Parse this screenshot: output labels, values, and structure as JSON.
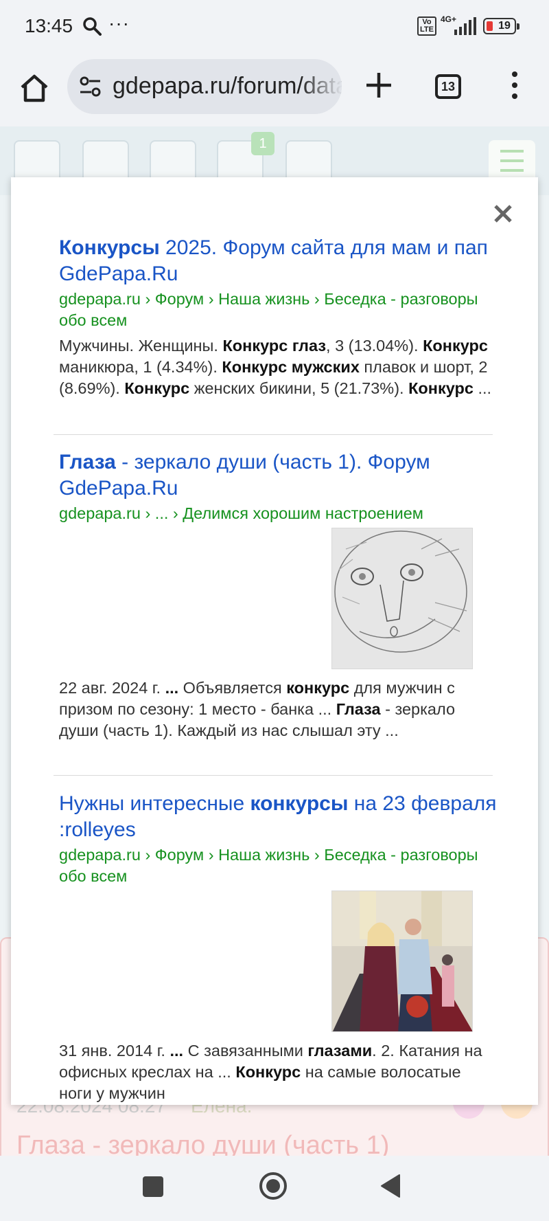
{
  "status_bar": {
    "time": "13:45",
    "overflow": "···",
    "volte": "Vo\nLTE",
    "network": "4G+",
    "battery": "19",
    "icons": [
      "search-icon",
      "volte-icon",
      "signal-icon",
      "battery-icon"
    ]
  },
  "browser": {
    "url": "gdepapa.ru/forum/data",
    "tabs_count": "13",
    "icons": [
      "home-icon",
      "tune-icon",
      "plus-icon",
      "tabs-icon",
      "more-vert-icon"
    ]
  },
  "site": {
    "nav_badge": "1",
    "bg_date": "22.08.2024 08:27",
    "bg_author": "Елена.",
    "bg_title": "Глаза - зеркало души (часть 1)",
    "bg_dots": "•••",
    "nav_icons": [
      "house-icon",
      "search-icon",
      "login-icon",
      "mail-icon",
      "bell-icon",
      "hamburger-icon"
    ]
  },
  "popup": {
    "close_icon": "close-icon",
    "results": [
      {
        "title_bold": "Конкурсы",
        "title_rest": " 2025. Форум сайта для мам и пап GdePapa.Ru",
        "crumb": "gdepapa.ru › Форум › Наша жизнь › Беседка - разговоры обо всем",
        "s1": "Мужчины. Женщины. ",
        "s2": "Конкурс глаз",
        "s3": ", 3 (13.04%). ",
        "s4": "Конкурс",
        "s5": " маникюра, 1 (4.34%). ",
        "s6": "Конкурс мужских",
        "s7": " плавок и шорт, 2 (8.69%). ",
        "s8": "Конкурс",
        "s9": " женских бикини, 5 (21.73%). ",
        "s10": "Конкурс",
        "s11": " ..."
      },
      {
        "title_bold": "Глаза",
        "title_rest": " - зеркало души (часть 1). Форум GdePapa.Ru",
        "crumb": "gdepapa.ru › ... › Делимся хорошим настроением",
        "thumb": "drawing-of-face",
        "s1": "22 авг. 2024 г. ",
        "s2": "...",
        "s3": " Объявляется ",
        "s4": "конкурс",
        "s5": " для мужчин с призом по сезону: 1 место - банка ... ",
        "s6": "Глаза",
        "s7": " - зеркало души (часть 1). Каждый из нас слышал эту ..."
      },
      {
        "title_1": "Нужны интересные ",
        "title_bold": "конкурсы",
        "title_rest": " на 23 февраля :rolleyes",
        "crumb": "gdepapa.ru › Форум › Наша жизнь › Беседка - разговоры обо всем",
        "thumb": "couple-photo",
        "s1": "31 янв. 2014 г. ",
        "s2": "...",
        "s3": " С завязанными ",
        "s4": "глазами",
        "s5": ". 2. Катания на офисных креслах на ... ",
        "s6": "Конкурс",
        "s7": " на самые волосатые ноги у мужчин"
      }
    ]
  },
  "nav_bar": {
    "icons": [
      "recents-square-icon",
      "home-circle-icon",
      "back-triangle-icon"
    ]
  }
}
